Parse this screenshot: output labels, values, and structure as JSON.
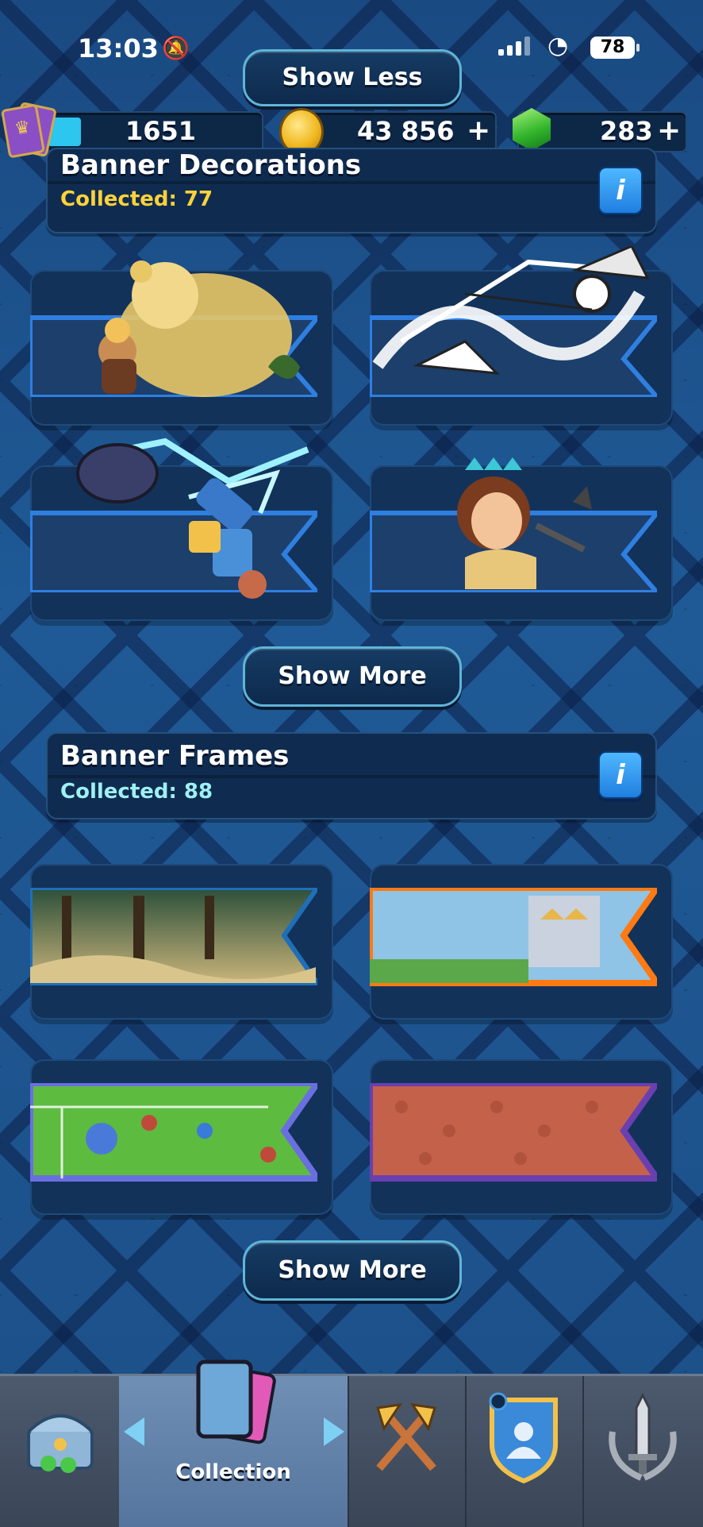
{
  "status_bar": {
    "time": "13:03",
    "battery": "78"
  },
  "top_button": {
    "label": "Show Less"
  },
  "resources": {
    "trophy_count": "1651",
    "gold": "43 856",
    "gems": "283",
    "plus": "+"
  },
  "sections": {
    "decorations": {
      "title": "Banner Decorations",
      "collected": "Collected: 77",
      "info": "i"
    },
    "frames": {
      "title": "Banner Frames",
      "collected": "Collected: 88",
      "info": "i"
    }
  },
  "show_more": {
    "label": "Show More"
  },
  "nav": {
    "active_label": "Collection"
  },
  "colors": {
    "accent": "#5fb5d8",
    "gold_text": "#ffd23a",
    "teal_text": "#9ff0f3",
    "nav_active": "#6f8fb5"
  }
}
